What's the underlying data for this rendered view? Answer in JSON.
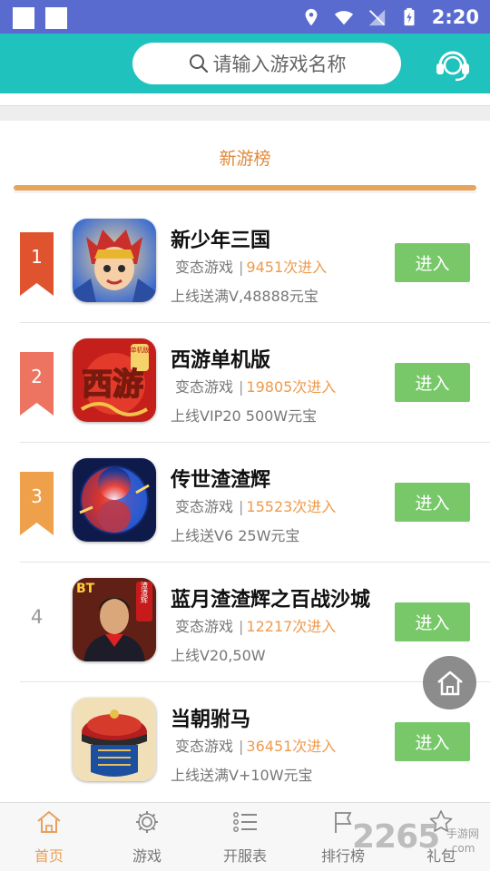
{
  "status_bar": {
    "time": "2:20"
  },
  "header": {
    "search_placeholder": "请输入游戏名称"
  },
  "section": {
    "title": "新游榜"
  },
  "games": [
    {
      "rank": "1",
      "name": "新少年三国",
      "type": "变态游戏",
      "plays": "9451次进入",
      "desc": "上线送满V,48888元宝",
      "button": "进入"
    },
    {
      "rank": "2",
      "name": "西游单机版",
      "type": "变态游戏",
      "plays": "19805次进入",
      "desc": "上线VIP20 500W元宝",
      "button": "进入"
    },
    {
      "rank": "3",
      "name": "传世渣渣辉",
      "type": "变态游戏",
      "plays": "15523次进入",
      "desc": "上线送V6 25W元宝",
      "button": "进入"
    },
    {
      "rank": "4",
      "name": "蓝月渣渣辉之百战沙城",
      "type": "变态游戏",
      "plays": "12217次进入",
      "desc": "上线V20,50W",
      "button": "进入"
    },
    {
      "rank": "",
      "name": "当朝驸马",
      "type": "变态游戏",
      "plays": "36451次进入",
      "desc": "上线送满V+10W元宝",
      "button": "进入"
    }
  ],
  "icon_text": {
    "xiyou_big": "西游",
    "xiyou_tag": "单机版",
    "bt": "BT",
    "zzh": "渣渣辉"
  },
  "bottom_nav": [
    {
      "label": "首页",
      "icon": "home-icon"
    },
    {
      "label": "游戏",
      "icon": "gear-icon"
    },
    {
      "label": "开服表",
      "icon": "list-icon"
    },
    {
      "label": "排行榜",
      "icon": "flag-icon"
    },
    {
      "label": "礼包",
      "icon": "star-icon"
    }
  ],
  "watermark": {
    "number": "2265",
    "site": "手游网",
    "domain": ".com"
  },
  "colors": {
    "status_bar": "#5a6bd0",
    "header": "#1fc2bd",
    "accent_orange": "#e8a35f",
    "enter_button": "#78c86a",
    "rank1": "#e0532f",
    "rank2": "#ec7461",
    "rank3": "#eea04a"
  }
}
